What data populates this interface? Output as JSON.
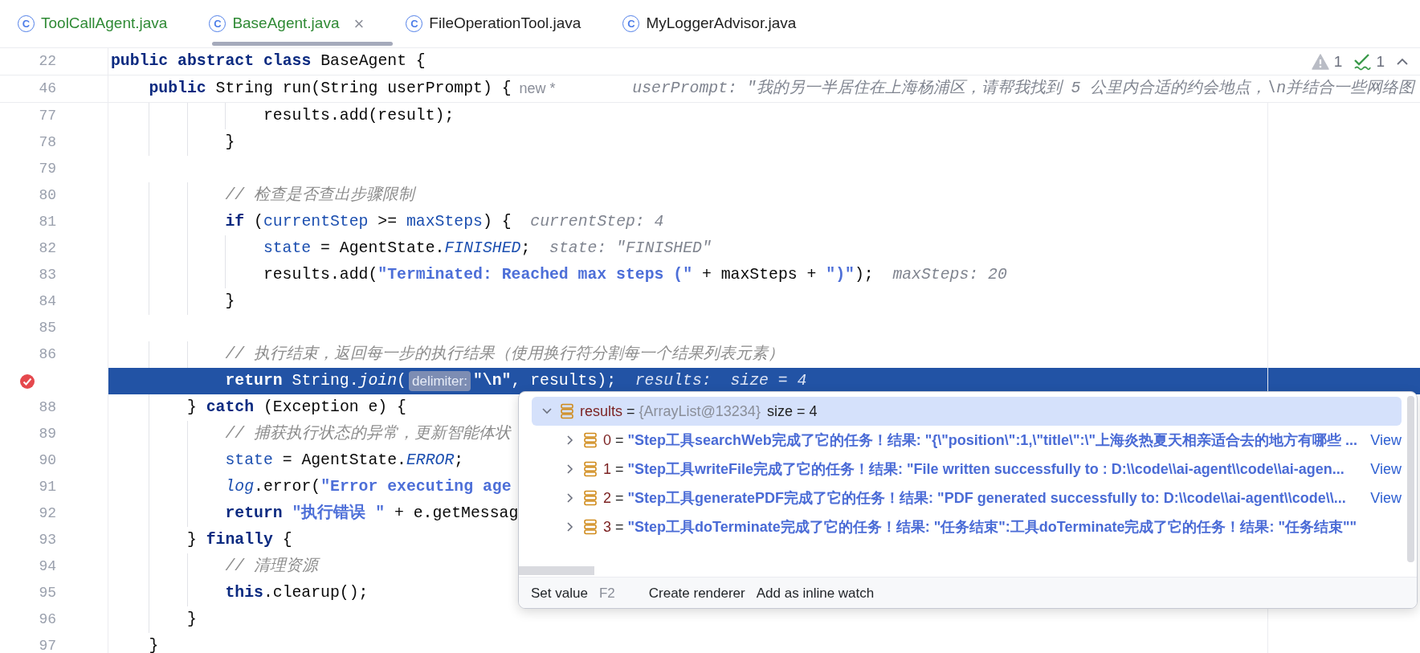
{
  "tabs": [
    {
      "icon_letter": "C",
      "label": "ToolCallAgent.java",
      "modified": true,
      "selected": false
    },
    {
      "icon_letter": "C",
      "label": "BaseAgent.java",
      "modified": true,
      "selected": true,
      "close_glyph": "×"
    },
    {
      "icon_letter": "C",
      "label": "FileOperationTool.java",
      "modified": false,
      "selected": false
    },
    {
      "icon_letter": "C",
      "label": "MyLoggerAdvisor.java",
      "modified": false,
      "selected": false
    }
  ],
  "inspections": [
    {
      "kind": "warning",
      "count": "1"
    },
    {
      "kind": "typo",
      "count": "1"
    }
  ],
  "editor": {
    "sticky_lines": [
      {
        "number": "22",
        "tokens": [
          {
            "kind": "kw",
            "text": "public abstract class"
          },
          {
            "kind": "plain",
            "text": " BaseAgent {"
          }
        ]
      },
      {
        "number": "46",
        "tokens": [
          {
            "kind": "kw",
            "text": "    public"
          },
          {
            "kind": "plain",
            "text": " String run(String userPrompt) {"
          },
          {
            "kind": "label",
            "text": "new *"
          },
          {
            "kind": "hint",
            "text": "userPrompt: \"我的另一半居住在上海杨浦区，请帮我找到 5 公里内合适的约会地点，\\n并结合一些网络图"
          }
        ]
      }
    ],
    "lines": [
      {
        "number": "77",
        "selected": false,
        "breakpoint": false,
        "tokens": [
          {
            "kind": "plain",
            "text": "                results.add(result);"
          }
        ]
      },
      {
        "number": "78",
        "selected": false,
        "breakpoint": false,
        "tokens": [
          {
            "kind": "plain",
            "text": "            }"
          }
        ]
      },
      {
        "number": "79",
        "selected": false,
        "breakpoint": false
      },
      {
        "number": "80",
        "selected": false,
        "breakpoint": false,
        "tokens": [
          {
            "kind": "comment",
            "text": "            // 检查是否查出步骤限制"
          }
        ]
      },
      {
        "number": "81",
        "selected": false,
        "breakpoint": false,
        "tokens": [
          {
            "kind": "kw",
            "text": "            if"
          },
          {
            "kind": "plain",
            "text": " ("
          },
          {
            "kind": "field",
            "text": "currentStep"
          },
          {
            "kind": "plain",
            "text": " >= "
          },
          {
            "kind": "field",
            "text": "maxSteps"
          },
          {
            "kind": "plain",
            "text": ") {"
          },
          {
            "kind": "hint",
            "text": "currentStep: 4"
          }
        ]
      },
      {
        "number": "82",
        "selected": false,
        "breakpoint": false,
        "tokens": [
          {
            "kind": "field",
            "text": "                state"
          },
          {
            "kind": "plain",
            "text": " = AgentState."
          },
          {
            "kind": "static_field",
            "text": "FINISHED"
          },
          {
            "kind": "plain",
            "text": ";"
          },
          {
            "kind": "hint",
            "text": "state: \"FINISHED\""
          }
        ]
      },
      {
        "number": "83",
        "selected": false,
        "breakpoint": false,
        "tokens": [
          {
            "kind": "plain",
            "text": "                results.add("
          },
          {
            "kind": "str",
            "text": "\"Terminated: Reached max steps (\""
          },
          {
            "kind": "plain",
            "text": " + maxSteps + "
          },
          {
            "kind": "str",
            "text": "\")\""
          },
          {
            "kind": "plain",
            "text": ");"
          },
          {
            "kind": "hint",
            "text": "maxSteps: 20"
          }
        ]
      },
      {
        "number": "84",
        "selected": false,
        "breakpoint": false,
        "tokens": [
          {
            "kind": "plain",
            "text": "            }"
          }
        ]
      },
      {
        "number": "85",
        "selected": false,
        "breakpoint": false
      },
      {
        "number": "86",
        "selected": false,
        "breakpoint": false,
        "tokens": [
          {
            "kind": "comment",
            "text": "            // 执行结束，返回每一步的执行结果（使用换行符分割每一个结果列表元素）"
          }
        ]
      },
      {
        "selected": true,
        "breakpoint": true,
        "tokens": [
          {
            "kind": "kw",
            "text": "            return"
          },
          {
            "kind": "plain",
            "text": " String."
          },
          {
            "kind": "static_call",
            "text": "join"
          },
          {
            "kind": "plain",
            "text": "("
          },
          {
            "kind": "chip",
            "text": "delimiter:"
          },
          {
            "kind": "str",
            "text": "\"\\n\""
          },
          {
            "kind": "plain",
            "text": ", results);"
          },
          {
            "kind": "hint",
            "text": "results:  size = 4"
          }
        ]
      },
      {
        "number": "88",
        "selected": false,
        "breakpoint": false,
        "tokens": [
          {
            "kind": "plain",
            "text": "        } "
          },
          {
            "kind": "kw",
            "text": "catch"
          },
          {
            "kind": "plain",
            "text": " (Exception e) {"
          }
        ]
      },
      {
        "number": "89",
        "selected": false,
        "breakpoint": false,
        "tokens": [
          {
            "kind": "comment",
            "text": "            // 捕获执行状态的异常，更新智能体状"
          }
        ]
      },
      {
        "number": "90",
        "selected": false,
        "breakpoint": false,
        "tokens": [
          {
            "kind": "field",
            "text": "            state"
          },
          {
            "kind": "plain",
            "text": " = AgentState."
          },
          {
            "kind": "static_field",
            "text": "ERROR"
          },
          {
            "kind": "plain",
            "text": ";"
          }
        ]
      },
      {
        "number": "91",
        "selected": false,
        "breakpoint": false,
        "tokens": [
          {
            "kind": "static_field",
            "text": "            log"
          },
          {
            "kind": "plain",
            "text": ".error("
          },
          {
            "kind": "str",
            "text": "\"Error executing age"
          }
        ]
      },
      {
        "number": "92",
        "selected": false,
        "breakpoint": false,
        "tokens": [
          {
            "kind": "kw",
            "text": "            return"
          },
          {
            "kind": "str",
            "text": " \"执行错误 \""
          },
          {
            "kind": "plain",
            "text": " + e.getMessag"
          }
        ]
      },
      {
        "number": "93",
        "selected": false,
        "breakpoint": false,
        "tokens": [
          {
            "kind": "plain",
            "text": "        } "
          },
          {
            "kind": "kw",
            "text": "finally"
          },
          {
            "kind": "plain",
            "text": " {"
          }
        ]
      },
      {
        "number": "94",
        "selected": false,
        "breakpoint": false,
        "tokens": [
          {
            "kind": "comment",
            "text": "            // 清理资源"
          }
        ]
      },
      {
        "number": "95",
        "selected": false,
        "breakpoint": false,
        "tokens": [
          {
            "kind": "kw",
            "text": "            this"
          },
          {
            "kind": "plain",
            "text": ".clearup();"
          }
        ]
      },
      {
        "number": "96",
        "selected": false,
        "breakpoint": false,
        "tokens": [
          {
            "kind": "plain",
            "text": "        }"
          }
        ]
      },
      {
        "number": "97",
        "selected": false,
        "breakpoint": false,
        "tokens": [
          {
            "kind": "plain",
            "text": "    }"
          }
        ]
      }
    ]
  },
  "debug_popup": {
    "root": {
      "name": "results",
      "separator": "=",
      "type": "{ArrayList@13234}",
      "size": "size = 4",
      "expanded": true,
      "selected": true
    },
    "children": [
      {
        "index": "0",
        "separator": "=",
        "value": "\"Step工具searchWeb完成了它的任务！结果: \"{\\\"position\\\":1,\\\"title\\\":\\\"上海炎热夏天相亲适合去的地方有哪些 ...",
        "view": "View",
        "expanded": false
      },
      {
        "index": "1",
        "separator": "=",
        "value": "\"Step工具writeFile完成了它的任务！结果: \"File written successfully to : D:\\\\code\\\\ai-agent\\\\code\\\\ai-agen...",
        "view": "View",
        "expanded": false
      },
      {
        "index": "2",
        "separator": "=",
        "value": "\"Step工具generatePDF完成了它的任务！结果: \"PDF generated successfully to: D:\\\\code\\\\ai-agent\\\\code\\\\...",
        "view": "View",
        "expanded": false
      },
      {
        "index": "3",
        "separator": "=",
        "value": "\"Step工具doTerminate完成了它的任务！结果: \"任务结束\":工具doTerminate完成了它的任务！结果: \"任务结束\"\"",
        "expanded": false
      }
    ],
    "actions": [
      {
        "label": "Set value",
        "shortcut": "F2"
      },
      {
        "label": "Create renderer"
      },
      {
        "label": "Add as inline watch"
      }
    ]
  }
}
